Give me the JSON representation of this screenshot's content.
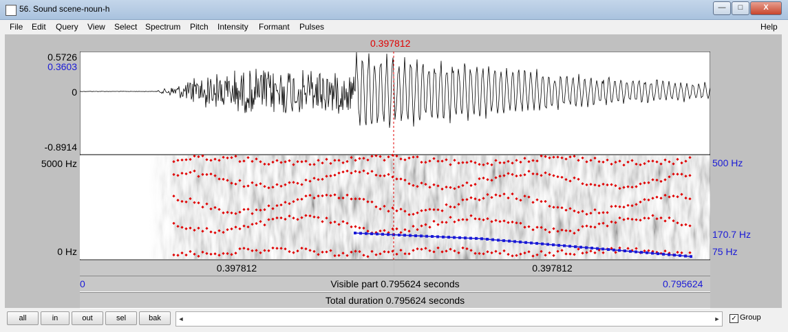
{
  "window": {
    "title": "56. Sound scene-noun-h",
    "minimize_glyph": "—",
    "maximize_glyph": "□",
    "close_glyph": "X"
  },
  "menu": {
    "items": [
      "File",
      "Edit",
      "Query",
      "View",
      "Select",
      "Spectrum",
      "Pitch",
      "Intensity",
      "Formant",
      "Pulses"
    ],
    "help": "Help"
  },
  "cursor": {
    "time_label": "0.397812"
  },
  "waveform": {
    "max_label": "0.5726",
    "cursor_amp_label": "0.3603",
    "zero_label": "0",
    "min_label": "-0.8914"
  },
  "spectrogram": {
    "top_freq_label": "5000 Hz",
    "bottom_freq_label": "0 Hz",
    "right_top_label": "500 Hz",
    "right_pitch_label": "170.7 Hz",
    "right_bottom_label": "75 Hz"
  },
  "bars": {
    "left_segment": "0.397812",
    "right_segment": "0.397812",
    "visible_start": "0",
    "visible_text": "Visible part 0.795624 seconds",
    "visible_end": "0.795624",
    "total_text": "Total duration 0.795624 seconds"
  },
  "buttons": [
    "all",
    "in",
    "out",
    "sel",
    "bak"
  ],
  "scroll": {
    "left_arrow": "◄",
    "right_arrow": "►"
  },
  "group": {
    "label": "Group",
    "checked": true,
    "check_glyph": "✓"
  },
  "colors": {
    "cursor": "#e00000",
    "pitch": "#1a1ad6",
    "formant": "#e00000",
    "axis_blue": "#1a1ad6"
  }
}
